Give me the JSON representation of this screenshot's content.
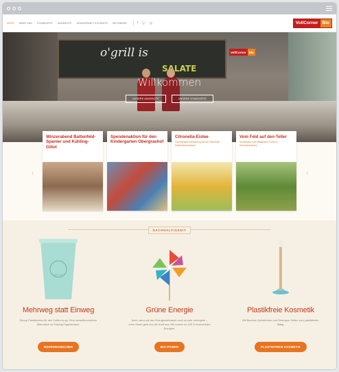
{
  "colors": {
    "accent": "#e8741f",
    "brand_red": "#c41e1e",
    "brand_orange": "#e8861d",
    "title_red": "#c43a1c"
  },
  "nav": {
    "items": [
      "SHOP",
      "ÜBER UNS",
      "STANDORTE",
      "ANGEBOTE",
      "GENUSSWELT & EVENTS",
      "NETZWERK"
    ],
    "social_icons": [
      "facebook-icon",
      "twitter-icon",
      "instagram-icon"
    ]
  },
  "logo": {
    "part1": "VollCorner",
    "part2": "Bio"
  },
  "hero": {
    "board_text": "o'grill is",
    "board_sale": "SALATE",
    "shop_logo_1": "VollCorner",
    "shop_logo_2": "Bio",
    "welcome": "Willkommen",
    "buttons": [
      "UNSERE ANGEBOTE",
      "UNSERE STANDORTE"
    ]
  },
  "cards": [
    {
      "title": "Winzerabend Battenfeld-Spanier und Kühling-Gillot",
      "sub": ""
    },
    {
      "title": "Spendenaktion für den Kindergarten Obergrashof",
      "sub": ""
    },
    {
      "title": "Citronella-Eistee",
      "sub": "Sommerliche Erfrischung mit der Citronella-Kräuterbrennnessel"
    },
    {
      "title": "Vom Feld auf den Teller",
      "sub": "Kundentour zum Biolandhof Fuchs in Schrobenhausen"
    }
  ],
  "section": {
    "label": "NACHHALTIGKEIT",
    "columns": [
      {
        "cup_text": "RECUP",
        "title": "Mehrweg statt Einweg",
        "desc": "Recup Pfandbecher für den Coffee-to-go. Eine umweltfreundliche Alternative zu Einweg-Pappbechern.",
        "button": "MEHRWEGBECHER"
      },
      {
        "title": "Grüne Energie",
        "desc": "Auch, wenn wir den Energieverbrauch noch so sehr verringern – ohne Strom geht uns die Kraft aus: Wir nutzen zu 100 % erneuerbare Energien.",
        "button": "BIO-POWER"
      },
      {
        "title": "Plastikfreie Kosmetik",
        "desc": "Mit Bambus Zahnbürsten und Shampoo Seifen zum plastikfreien Alltag.",
        "button": "PLASTIKFREIE KOSMETIK"
      }
    ]
  }
}
